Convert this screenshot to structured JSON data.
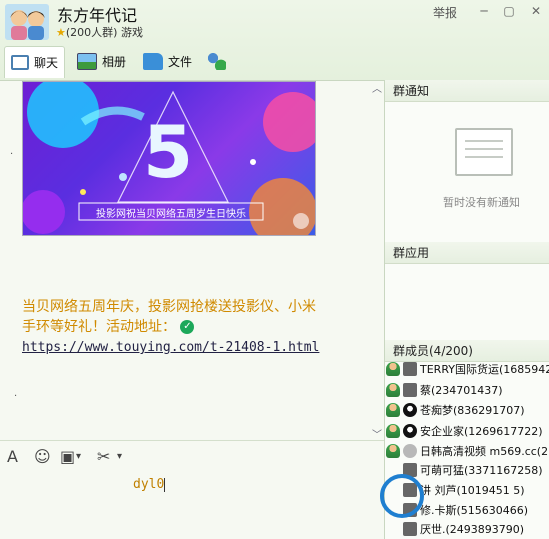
{
  "header": {
    "title": "东方年代记",
    "subtitle_count": "(200人群)",
    "subtitle_tag": "游戏",
    "report": "举报"
  },
  "tabs": [
    {
      "label": "聊天"
    },
    {
      "label": "相册"
    },
    {
      "label": "文件"
    }
  ],
  "chat": {
    "banner_number": "5",
    "banner_caption": "投影网祝当贝网络五周岁生日快乐",
    "message_line1": "当贝网络五周年庆，投影网抢楼送投影仪、小米",
    "message_line2": "手环等好礼！活动地址：",
    "link": "https://www.touying.com/t-21408-1.html"
  },
  "input": {
    "text": "dyl0"
  },
  "right": {
    "notice_title": "群通知",
    "notice_empty": "暂时没有新通知",
    "apps_title": "群应用",
    "members_title": "群成员(4/200)",
    "members": [
      {
        "name": "TERRY国际货运(1685942",
        "icon": "pic"
      },
      {
        "name": "蔡(234701437)",
        "icon": "pic"
      },
      {
        "name": "苍痴梦(836291707)",
        "icon": "qq"
      },
      {
        "name": "安企业家(1269617722)",
        "icon": "qq"
      },
      {
        "name": "日韩高清视频  m569.cc(2",
        "icon": "gray"
      },
      {
        "name": "可萌可猛(3371167258)",
        "icon": "pic"
      },
      {
        "name": "讲 刘芦(1019451 5)",
        "icon": "pic"
      },
      {
        "name": "修.卡斯(515630466)",
        "icon": "pic"
      },
      {
        "name": "厌世.(2493893790)",
        "icon": "pic"
      }
    ]
  }
}
